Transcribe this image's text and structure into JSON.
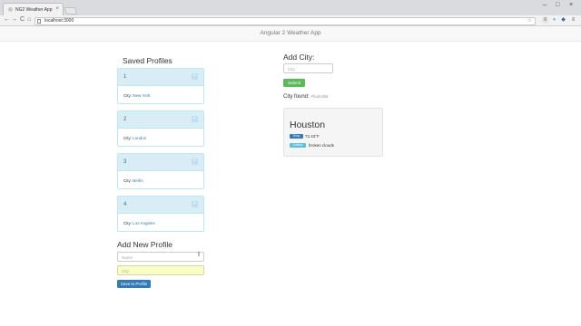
{
  "browser": {
    "tab_title": "NG2 Weather App",
    "tab_close": "×",
    "url": "localhost:3000",
    "back": "←",
    "forward": "→",
    "reload": "C",
    "home": "⌂",
    "minimize": "–",
    "maximize": "□",
    "close": "×"
  },
  "app": {
    "brand": "Angular 2 Weather App"
  },
  "saved_profiles": {
    "title": "Saved Profiles",
    "city_label": "City:",
    "remove_glyph": "×",
    "items": [
      {
        "num": "1",
        "city": "New York"
      },
      {
        "num": "2",
        "city": "London"
      },
      {
        "num": "3",
        "city": "Berlin"
      },
      {
        "num": "4",
        "city": "Los Angeles"
      }
    ]
  },
  "new_profile": {
    "title": "Add New Profile",
    "name_placeholder": "Name",
    "city_placeholder": "City",
    "save_label": "Save to Profile"
  },
  "add_city": {
    "title": "Add City:",
    "city_placeholder": "City",
    "submit_label": "Submit"
  },
  "city_found": {
    "label": "City found:",
    "value": "#foobcbB"
  },
  "weather": {
    "city": "Houston",
    "temp_badge": "Temp",
    "temp": "72.43°F",
    "desc_badge": "Outlook",
    "desc": "broken clouds"
  },
  "colors": {
    "panel_header": "#d9edf7",
    "primary": "#337ab7",
    "success": "#5cb85c",
    "info": "#5bc0de"
  }
}
